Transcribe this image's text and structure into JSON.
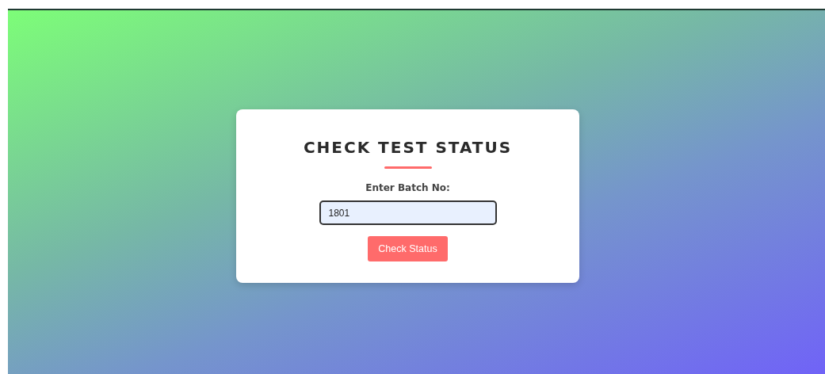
{
  "card": {
    "title": "CHECK TEST STATUS",
    "field_label": "Enter Batch No:",
    "batch_field": {
      "value": "1801"
    },
    "button": "Check Status"
  }
}
